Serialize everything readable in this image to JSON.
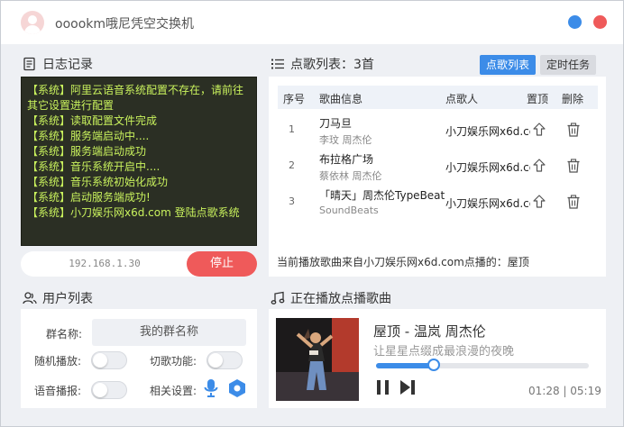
{
  "app": {
    "title": "ooookm哦尼凭空交换机"
  },
  "colors": {
    "accent": "#3c8ce8",
    "danger": "#ef5a5a",
    "log_text": "#c9f25d",
    "log_bg": "#2b2f24"
  },
  "log": {
    "title": "日志记录",
    "lines": [
      "【系统】阿里云语音系统配置不存在，请前往",
      "其它设置进行配置",
      "【系统】读取配置文件完成",
      "【系统】服务端启动中....",
      "【系统】服务端启动成功",
      "【系统】音乐系统开启中....",
      "【系统】音乐系统初始化成功",
      "【系统】启动服务端成功!",
      "【系统】小刀娱乐网x6d.com 登陆点歌系统"
    ]
  },
  "server": {
    "ip": "192.168.1.30",
    "stop_label": "停止"
  },
  "songs": {
    "title": "点歌列表：3首",
    "tabs": [
      "点歌列表",
      "定时任务"
    ],
    "headers": {
      "index": "序号",
      "info": "歌曲信息",
      "requester": "点歌人",
      "pin": "置顶",
      "delete": "删除"
    },
    "rows": [
      {
        "index": "1",
        "name": "刀马旦",
        "artist": "李玟    周杰伦",
        "requester": "小刀娱乐网x6d.com"
      },
      {
        "index": "2",
        "name": "布拉格广场",
        "artist": "蔡依林    周杰伦",
        "requester": "小刀娱乐网x6d.com"
      },
      {
        "index": "3",
        "name": "「晴天」周杰伦TypeBeat",
        "artist": "SoundBeats",
        "requester": "小刀娱乐网x6d.com"
      }
    ],
    "now_source": "当前播放歌曲来自小刀娱乐网x6d.com点播的：屋顶"
  },
  "users": {
    "title": "用户列表",
    "group_label": "群名称:",
    "group_value": "我的群名称",
    "random_label": "随机播放:",
    "switch_label": "切歌功能:",
    "voice_label": "语音播报:",
    "related_label": "相关设置:"
  },
  "now_playing": {
    "title_section": "正在播放点播歌曲",
    "song_title": "屋顶 - 温岚  周杰伦",
    "lyric": "让星星点缀成最浪漫的夜晚",
    "progress": 0.27,
    "current_time": "01:28",
    "total_time": "05:19",
    "time_separator": " | "
  }
}
